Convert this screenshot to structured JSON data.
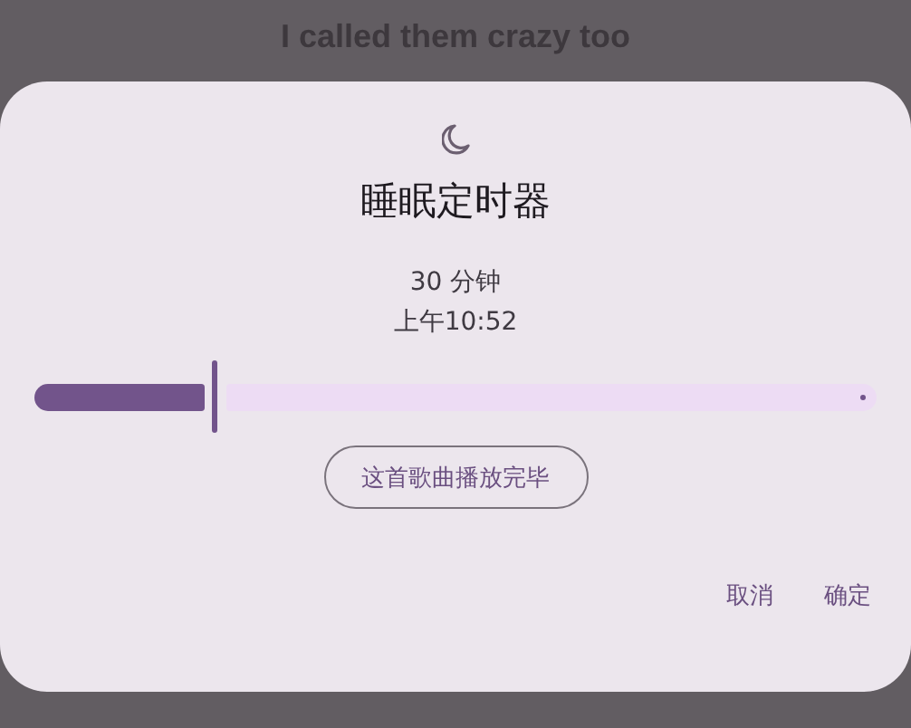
{
  "background_text": "I called them crazy too",
  "dialog": {
    "title": "睡眠定时器",
    "duration": "30 分钟",
    "end_time": "上午10:52",
    "slider": {
      "level": 0.217
    },
    "option_button": "这首歌曲播放完毕",
    "actions": [
      "取消",
      "确定"
    ]
  }
}
